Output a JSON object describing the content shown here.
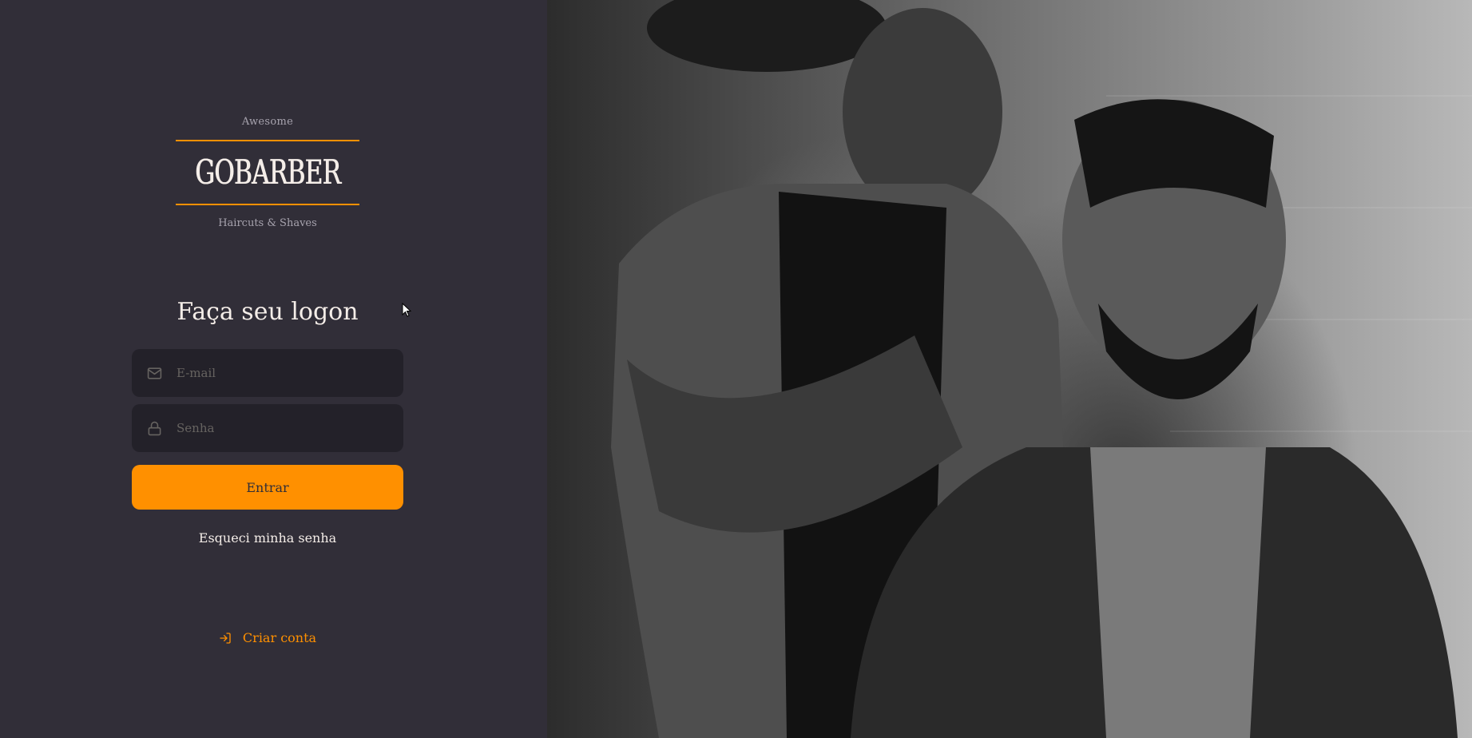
{
  "logo": {
    "top_text": "Awesome",
    "brand": "GOBARBER",
    "bottom_text": "Haircuts & Shaves",
    "accent_color": "#ff9000"
  },
  "form": {
    "title": "Faça seu logon",
    "email": {
      "placeholder": "E-mail",
      "value": "",
      "icon": "mail-icon"
    },
    "password": {
      "placeholder": "Senha",
      "value": "",
      "icon": "lock-icon"
    },
    "submit_label": "Entrar",
    "forgot_label": "Esqueci minha senha"
  },
  "create_account": {
    "label": "Criar conta",
    "icon": "log-in-icon"
  },
  "background_image": {
    "description_icon": "barber-photo"
  },
  "colors": {
    "background": "#312e38",
    "input_background": "#232129",
    "primary": "#ff9000",
    "text": "#f4ede8",
    "muted": "#666360"
  }
}
